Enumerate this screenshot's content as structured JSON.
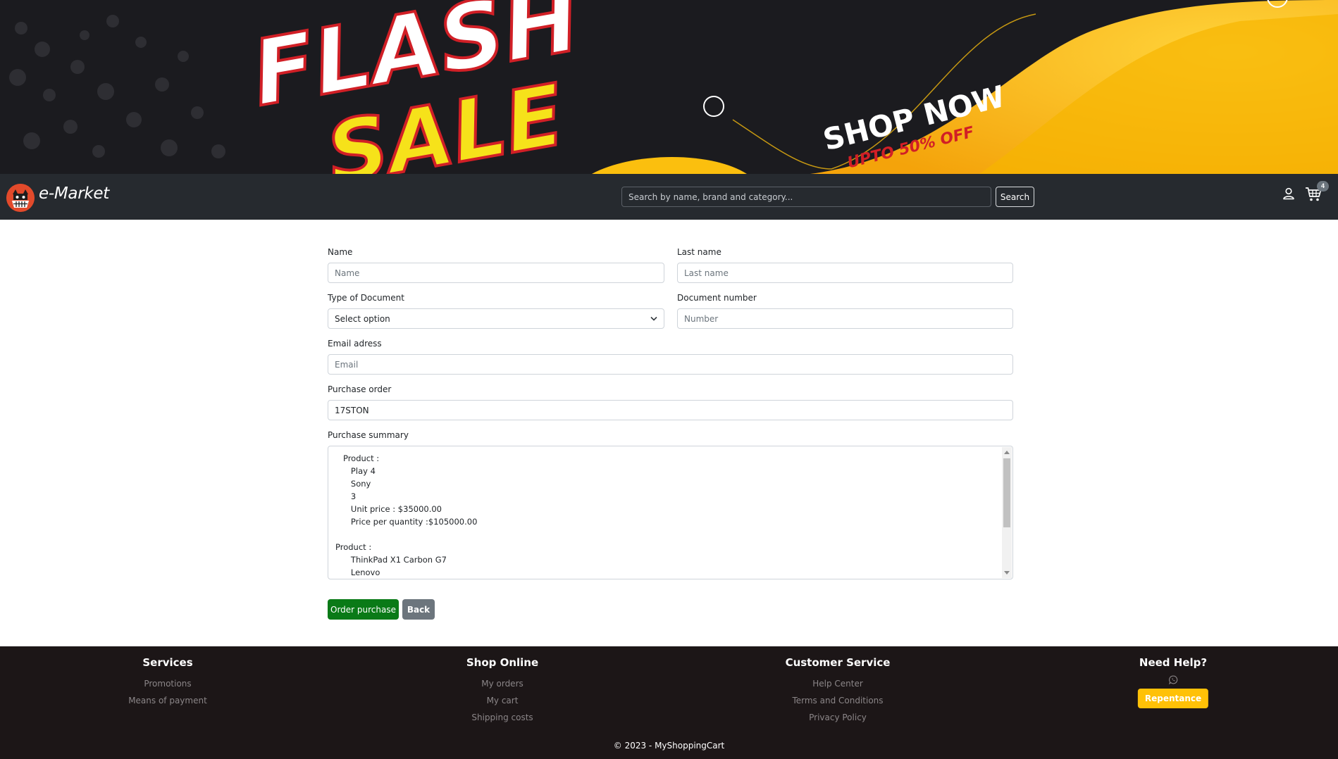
{
  "banner": {
    "headline_top": "FLASH",
    "headline_bottom": "SALE",
    "cta": "SHOP NOW",
    "offer": "UPTO 50% OFF"
  },
  "navbar": {
    "brand": "e-Market",
    "search_placeholder": "Search by name, brand and category...",
    "search_button": "Search",
    "cart_count": "4"
  },
  "form": {
    "name": {
      "label": "Name",
      "placeholder": "Name",
      "value": ""
    },
    "last_name": {
      "label": "Last name",
      "placeholder": "Last name",
      "value": ""
    },
    "doc_type": {
      "label": "Type of Document",
      "selected": "Select option"
    },
    "doc_number": {
      "label": "Document number",
      "placeholder": "Number",
      "value": ""
    },
    "email": {
      "label": "Email adress",
      "placeholder": "Email",
      "value": ""
    },
    "purchase_order": {
      "label": "Purchase order",
      "value": "17STON"
    },
    "summary": {
      "label": "Purchase summary",
      "text": "   Product :\n      Play 4\n      Sony\n      3\n      Unit price : $35000.00\n      Price per quantity :$105000.00\n\nProduct :\n      ThinkPad X1 Carbon G7\n      Lenovo"
    },
    "order_button": "Order purchase",
    "back_button": "Back"
  },
  "footer": {
    "services": {
      "title": "Services",
      "links": [
        "Promotions",
        "Means of payment"
      ]
    },
    "shop_online": {
      "title": "Shop Online",
      "links": [
        "My orders",
        "My cart",
        "Shipping costs"
      ]
    },
    "customer_service": {
      "title": "Customer Service",
      "links": [
        "Help Center",
        "Terms and Conditions",
        "Privacy Policy"
      ]
    },
    "help": {
      "title": "Need Help?",
      "icon": "whatsapp-icon",
      "button": "Repentance"
    },
    "copyright": "© 2023 - MyShoppingCart"
  },
  "colors": {
    "navbar": "#262a2f",
    "footer": "#1c1617",
    "order_button": "#0a7a17",
    "back_button": "#6c757d",
    "help_button": "#ffc107",
    "banner_yellow": "#fbbf0e"
  }
}
